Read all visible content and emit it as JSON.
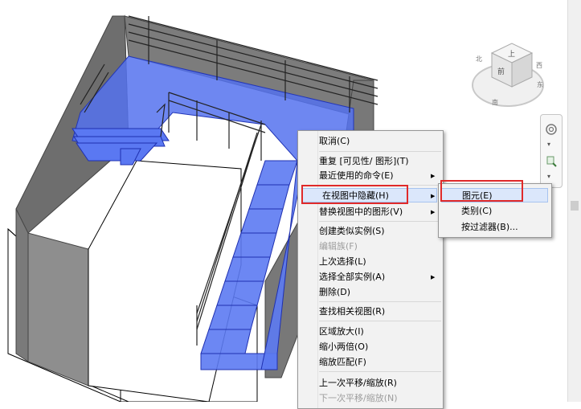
{
  "context_menu": {
    "items": [
      {
        "label": "取消(C)",
        "disabled": false
      },
      {
        "label": "重复 [可见性/ 图形](T)",
        "disabled": false
      },
      {
        "label": "最近使用的命令(E)",
        "disabled": false,
        "submenu": true
      },
      {
        "label": "在视图中隐藏(H)",
        "disabled": false,
        "submenu": true,
        "active": true
      },
      {
        "label": "替换视图中的图形(V)",
        "disabled": false,
        "submenu": true
      },
      {
        "label": "创建类似实例(S)",
        "disabled": false
      },
      {
        "label": "编辑族(F)",
        "disabled": true
      },
      {
        "label": "上次选择(L)",
        "disabled": false
      },
      {
        "label": "选择全部实例(A)",
        "disabled": false,
        "submenu": true
      },
      {
        "label": "删除(D)",
        "disabled": false
      },
      {
        "label": "查找相关视图(R)",
        "disabled": false
      },
      {
        "label": "区域放大(I)",
        "disabled": false
      },
      {
        "label": "缩小两倍(O)",
        "disabled": false
      },
      {
        "label": "缩放匹配(F)",
        "disabled": false
      },
      {
        "label": "上一次平移/缩放(R)",
        "disabled": false
      },
      {
        "label": "下一次平移/缩放(N)",
        "disabled": true
      }
    ]
  },
  "submenu": {
    "items": [
      {
        "label": "图元(E)",
        "active": true
      },
      {
        "label": "类别(C)",
        "active": false
      },
      {
        "label": "按过滤器(B)...",
        "active": false
      }
    ]
  },
  "viewcube": {
    "face_top": "上",
    "face_front": "前",
    "compass": [
      "北",
      "东",
      "南",
      "西"
    ]
  },
  "colors": {
    "selection_blue": "#4a6cf0",
    "wall_gray": "#767676",
    "highlight_red": "#e02a2a"
  },
  "icons": {
    "steering_wheel": "steering-wheel-icon",
    "zoom": "zoom-icon",
    "viewcube_home": "home-icon"
  }
}
